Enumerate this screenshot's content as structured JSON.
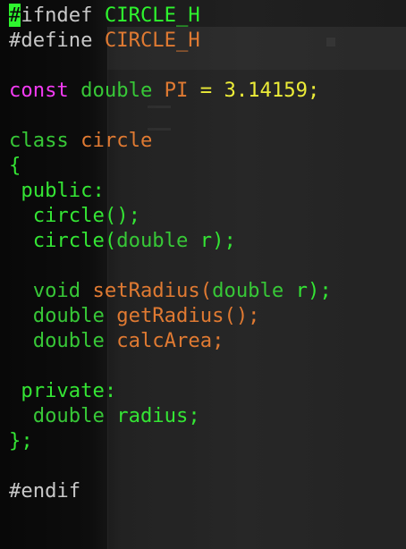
{
  "editor": {
    "lines": [
      {
        "parts": [
          {
            "text": "#",
            "cls": "cursor"
          },
          {
            "text": "ifndef ",
            "cls": "c-pre"
          },
          {
            "text": "CIRCLE_H",
            "cls": "c-id"
          }
        ]
      },
      {
        "parts": [
          {
            "text": "#define ",
            "cls": "c-pre"
          },
          {
            "text": "CIRCLE_H",
            "cls": "c-name"
          }
        ]
      },
      {
        "parts": []
      },
      {
        "parts": [
          {
            "text": "const ",
            "cls": "c-key"
          },
          {
            "text": "double ",
            "cls": "c-type"
          },
          {
            "text": "PI",
            "cls": "c-name"
          },
          {
            "text": " = ",
            "cls": "c-num"
          },
          {
            "text": "3.14159;",
            "cls": "c-num"
          }
        ]
      },
      {
        "parts": []
      },
      {
        "parts": [
          {
            "text": "class ",
            "cls": "c-type"
          },
          {
            "text": "circle",
            "cls": "c-name"
          }
        ]
      },
      {
        "parts": [
          {
            "text": "{",
            "cls": "c-green"
          }
        ]
      },
      {
        "parts": [
          {
            "text": " public:",
            "cls": "c-green"
          }
        ]
      },
      {
        "parts": [
          {
            "text": "  circle();",
            "cls": "c-green"
          }
        ]
      },
      {
        "parts": [
          {
            "text": "  circle(",
            "cls": "c-green"
          },
          {
            "text": "double ",
            "cls": "c-type"
          },
          {
            "text": "r);",
            "cls": "c-green"
          }
        ]
      },
      {
        "parts": []
      },
      {
        "parts": [
          {
            "text": "  void ",
            "cls": "c-type"
          },
          {
            "text": "setRadius(",
            "cls": "c-name"
          },
          {
            "text": "double ",
            "cls": "c-type"
          },
          {
            "text": "r);",
            "cls": "c-green"
          }
        ]
      },
      {
        "parts": [
          {
            "text": "  double ",
            "cls": "c-type"
          },
          {
            "text": "getRadius();",
            "cls": "c-name"
          }
        ]
      },
      {
        "parts": [
          {
            "text": "  double ",
            "cls": "c-type"
          },
          {
            "text": "calcArea;",
            "cls": "c-name"
          }
        ]
      },
      {
        "parts": []
      },
      {
        "parts": [
          {
            "text": " private:",
            "cls": "c-green"
          }
        ]
      },
      {
        "parts": [
          {
            "text": "  double ",
            "cls": "c-type"
          },
          {
            "text": "radius;",
            "cls": "c-green"
          }
        ]
      },
      {
        "parts": [
          {
            "text": "};",
            "cls": "c-green"
          }
        ]
      },
      {
        "parts": []
      },
      {
        "parts": [
          {
            "text": "#endif",
            "cls": "c-pre"
          }
        ]
      }
    ]
  },
  "colors": {
    "background": "#0b0b0b",
    "preprocessor": "#c8c8c8",
    "identifier": "#2ef52e",
    "keyword_const": "#f33bf3",
    "type": "#37c837",
    "name": "#e07a32",
    "number": "#ecec38",
    "cursor": "#2ef52e"
  }
}
